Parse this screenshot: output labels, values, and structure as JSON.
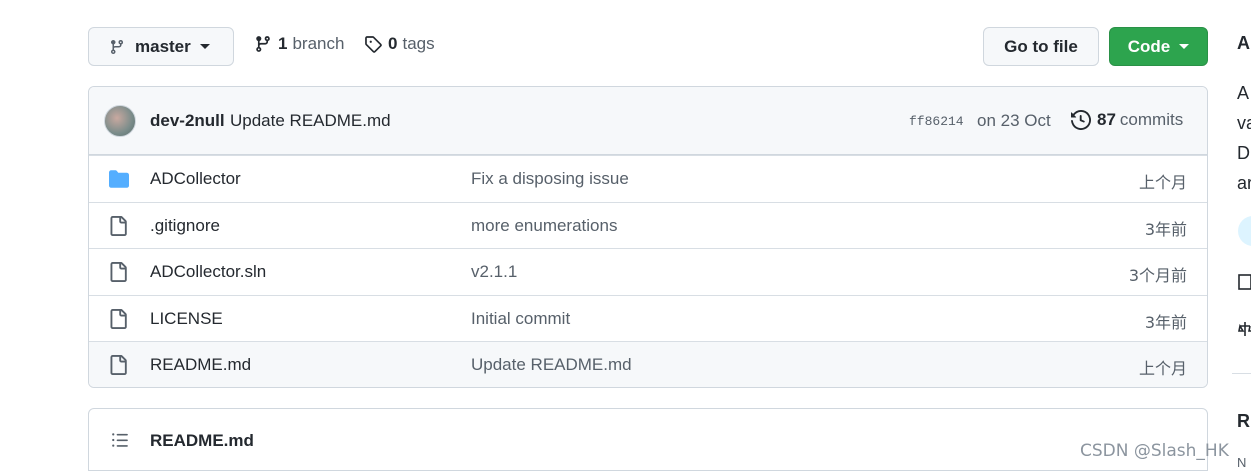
{
  "toolbar": {
    "branch_name": "master",
    "branch_count": "1",
    "branch_word": "branch",
    "tag_count": "0",
    "tag_word": "tags",
    "goto_file": "Go to file",
    "code": "Code"
  },
  "commit": {
    "author": "dev-2null",
    "message": "Update README.md",
    "sha": "ff86214",
    "date": "on 23 Oct",
    "count": "87",
    "count_word": "commits"
  },
  "files": [
    {
      "name": "ADCollector",
      "type": "folder",
      "message": "Fix a disposing issue",
      "age": "上个月"
    },
    {
      "name": ".gitignore",
      "type": "file",
      "message": "more enumerations",
      "age": "3年前"
    },
    {
      "name": "ADCollector.sln",
      "type": "file",
      "message": "v2.1.1",
      "age": "3个月前"
    },
    {
      "name": "LICENSE",
      "type": "file",
      "message": "Initial commit",
      "age": "3年前"
    },
    {
      "name": "README.md",
      "type": "file",
      "message": "Update README.md",
      "age": "上个月"
    }
  ],
  "readme": {
    "title": "README.md"
  },
  "sidebar_fragments": [
    "A",
    "A",
    "va",
    "D",
    "ar",
    "R",
    "N"
  ],
  "watermark": "CSDN @Slash_HK",
  "colors": {
    "primary_button": "#2da44e",
    "folder_icon": "#54aeff",
    "border": "#d0d7de"
  }
}
